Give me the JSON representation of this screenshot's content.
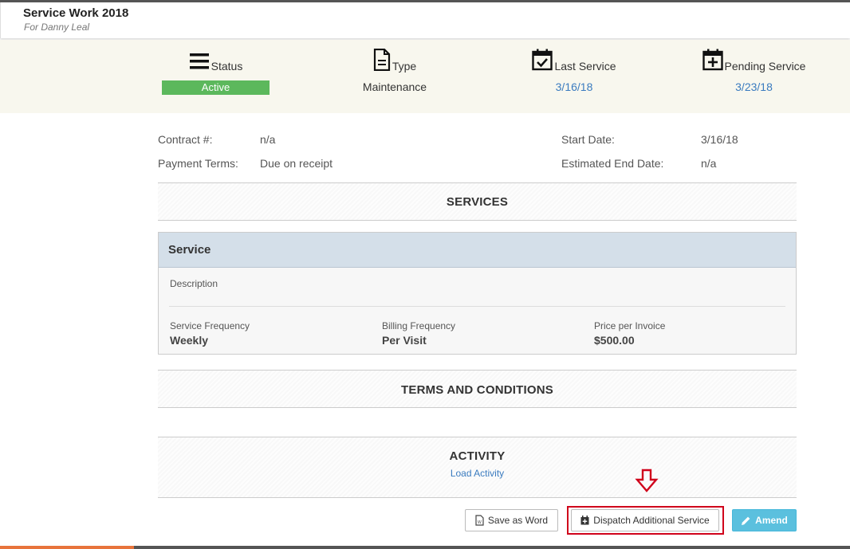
{
  "header": {
    "title": "Service Work 2018",
    "subtitle": "For Danny Leal"
  },
  "summary": {
    "status": {
      "icon": "menu-icon",
      "label": "Status",
      "value": "Active",
      "color": "#5cb85c"
    },
    "type": {
      "icon": "document-icon",
      "label": "Type",
      "value": "Maintenance"
    },
    "last_service": {
      "icon": "calendar-check-icon",
      "label": "Last Service",
      "value": "3/16/18"
    },
    "pending_service": {
      "icon": "calendar-plus-icon",
      "label": "Pending Service",
      "value": "3/23/18"
    }
  },
  "details": {
    "contract_label": "Contract #:",
    "contract_value": "n/a",
    "payment_terms_label": "Payment Terms:",
    "payment_terms_value": "Due on receipt",
    "start_date_label": "Start Date:",
    "start_date_value": "3/16/18",
    "end_date_label": "Estimated End Date:",
    "end_date_value": "n/a"
  },
  "sections": {
    "services": "SERVICES",
    "terms": "TERMS AND CONDITIONS",
    "activity": "ACTIVITY",
    "load_activity": "Load Activity"
  },
  "service_card": {
    "title": "Service",
    "description_label": "Description",
    "frequency_label": "Service Frequency",
    "frequency_value": "Weekly",
    "billing_label": "Billing Frequency",
    "billing_value": "Per Visit",
    "price_label": "Price per Invoice",
    "price_value": "$500.00"
  },
  "actions": {
    "save_word": "Save as Word",
    "dispatch": "Dispatch Additional Service",
    "amend": "Amend"
  },
  "colors": {
    "accent_link": "#3a7bbf",
    "amend_button": "#5bc0de",
    "highlight": "#d0021b",
    "summary_bg": "#f8f7ee"
  }
}
